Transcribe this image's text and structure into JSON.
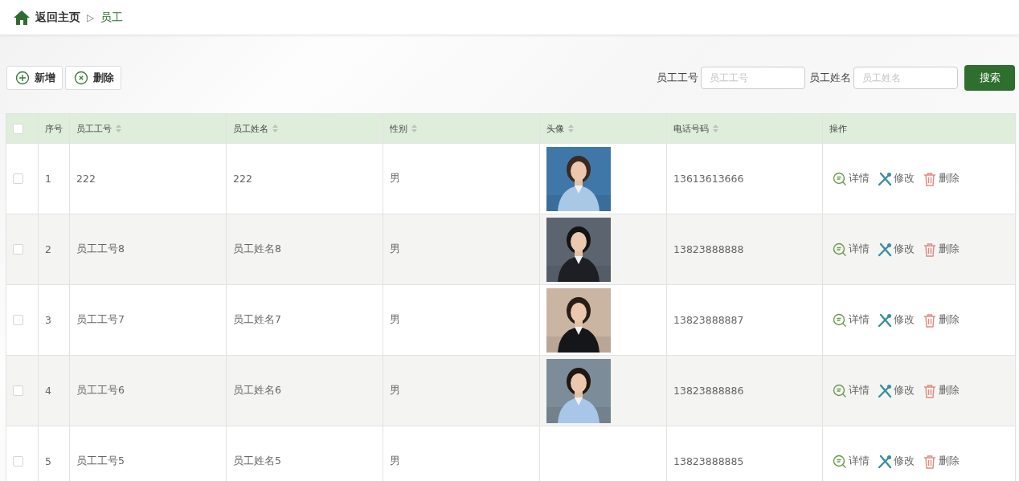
{
  "breadcrumb": {
    "home": "返回主页",
    "separator": "▷",
    "current": "员工"
  },
  "toolbar": {
    "buttons": [
      {
        "kind": "add",
        "label": "新增"
      },
      {
        "kind": "delete",
        "label": "删除"
      }
    ],
    "filters": [
      {
        "label": "员工工号",
        "placeholder": "员工工号"
      },
      {
        "label": "员工姓名",
        "placeholder": "员工姓名"
      }
    ],
    "search_button": "搜索"
  },
  "table": {
    "select_all": {
      "checked": false
    },
    "columns": [
      {
        "label": "序号",
        "sortable": false
      },
      {
        "label": "员工工号",
        "sortable": true
      },
      {
        "label": "员工姓名",
        "sortable": true
      },
      {
        "label": "性别",
        "sortable": true
      },
      {
        "label": "头像",
        "sortable": true
      },
      {
        "label": "电话号码",
        "sortable": true
      },
      {
        "label": "操作",
        "sortable": false
      }
    ],
    "rows": [
      {
        "checked": false,
        "index": "1",
        "emp_no": "222",
        "name": "222",
        "gender": "男",
        "phone": "13613613666",
        "actions": [
          {
            "kind": "detail",
            "label": "详情"
          },
          {
            "kind": "edit",
            "label": "修改"
          },
          {
            "kind": "delete",
            "label": "删除"
          }
        ]
      },
      {
        "checked": false,
        "index": "2",
        "emp_no": "员工工号8",
        "name": "员工姓名8",
        "gender": "男",
        "phone": "13823888888",
        "actions": [
          {
            "kind": "detail",
            "label": "详情"
          },
          {
            "kind": "edit",
            "label": "修改"
          },
          {
            "kind": "delete",
            "label": "删除"
          }
        ]
      },
      {
        "checked": false,
        "index": "3",
        "emp_no": "员工工号7",
        "name": "员工姓名7",
        "gender": "男",
        "phone": "13823888887",
        "actions": [
          {
            "kind": "detail",
            "label": "详情"
          },
          {
            "kind": "edit",
            "label": "修改"
          },
          {
            "kind": "delete",
            "label": "删除"
          }
        ]
      },
      {
        "checked": false,
        "index": "4",
        "emp_no": "员工工号6",
        "name": "员工姓名6",
        "gender": "男",
        "phone": "13823888886",
        "actions": [
          {
            "kind": "detail",
            "label": "详情"
          },
          {
            "kind": "edit",
            "label": "修改"
          },
          {
            "kind": "delete",
            "label": "删除"
          }
        ]
      },
      {
        "checked": false,
        "index": "5",
        "emp_no": "员工工号5",
        "name": "员工姓名5",
        "gender": "男",
        "phone": "13823888885",
        "actions": [
          {
            "kind": "detail",
            "label": "详情"
          },
          {
            "kind": "edit",
            "label": "修改"
          },
          {
            "kind": "delete",
            "label": "删除"
          }
        ]
      }
    ]
  }
}
